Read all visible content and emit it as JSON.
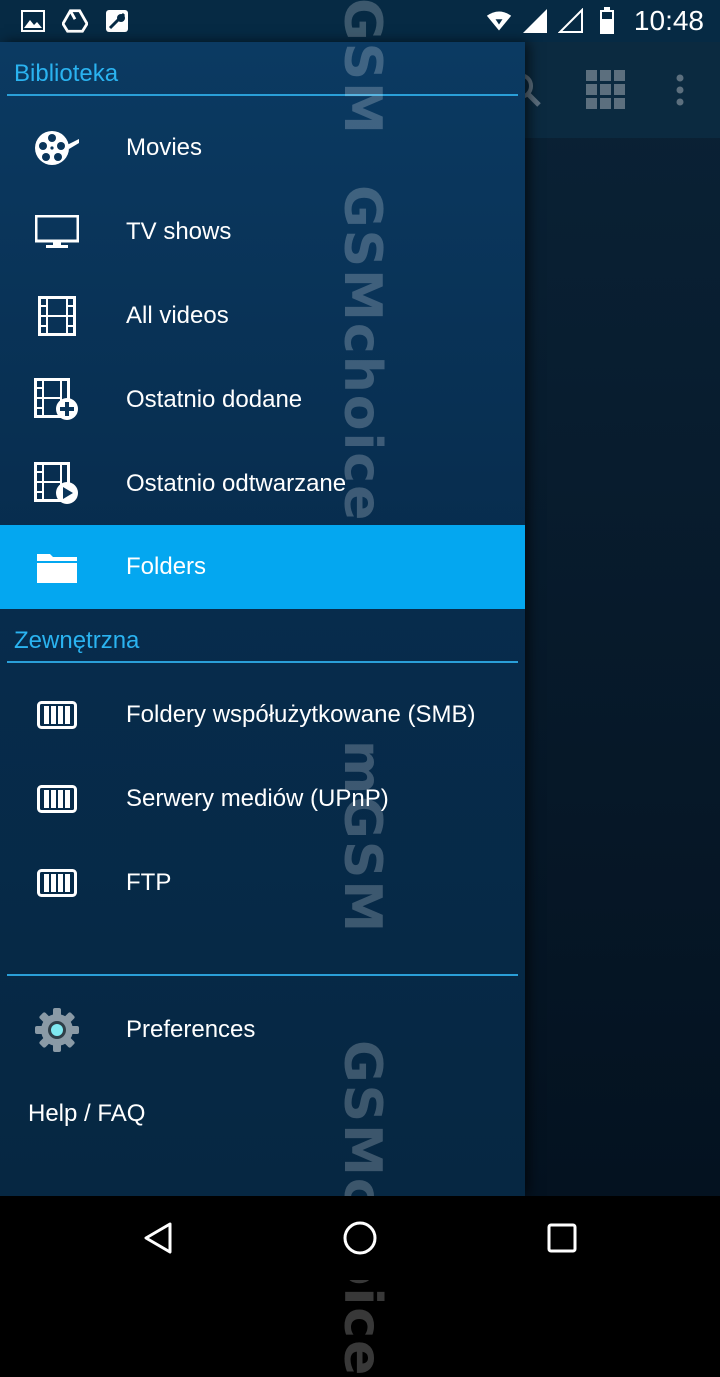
{
  "status_bar": {
    "time": "10:48",
    "left_icons": [
      "image-icon",
      "drive-icon",
      "maps-icon"
    ],
    "right_icons": [
      "wifi-icon",
      "signal-icon",
      "signal-empty-icon",
      "battery-icon"
    ]
  },
  "toolbar": {
    "icons": [
      "search-icon",
      "grid-view-icon",
      "overflow-menu-icon"
    ]
  },
  "drawer": {
    "sections": [
      {
        "label": "Biblioteka"
      },
      {
        "label": "Zewnętrzna"
      }
    ],
    "library_items": [
      {
        "label": "Movies",
        "icon": "movie-reel-icon"
      },
      {
        "label": "TV shows",
        "icon": "tv-icon"
      },
      {
        "label": "All videos",
        "icon": "film-strip-icon"
      },
      {
        "label": "Ostatnio dodane",
        "icon": "film-add-icon"
      },
      {
        "label": "Ostatnio odtwarzane",
        "icon": "film-play-icon"
      },
      {
        "label": "Folders",
        "icon": "folder-icon",
        "active": true
      }
    ],
    "external_items": [
      {
        "label": "Foldery współużytkowane (SMB)",
        "icon": "network-drive-icon"
      },
      {
        "label": "Serwery mediów (UPnP)",
        "icon": "network-drive-icon"
      },
      {
        "label": "FTP",
        "icon": "network-drive-icon"
      }
    ],
    "footer_items": [
      {
        "label": "Preferences",
        "icon": "gear-icon"
      },
      {
        "label": "Help / FAQ"
      }
    ]
  },
  "watermark": {
    "text_1": "GSM",
    "text_2": "GSMchoice",
    "text_3": "mGSM",
    "text_4": "GSMchoice"
  },
  "colors": {
    "accent": "#2ab3f0",
    "active_item": "#04a7f0",
    "drawer_bg": "#072c4d"
  }
}
